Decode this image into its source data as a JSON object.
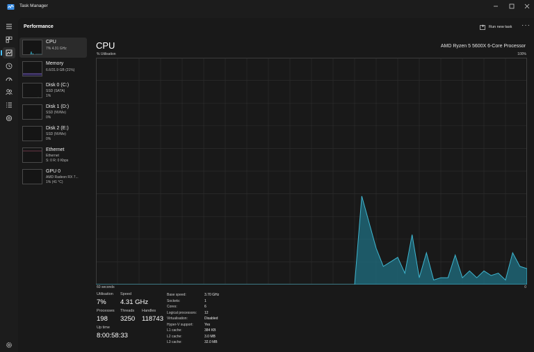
{
  "window": {
    "title": "Task Manager"
  },
  "header": {
    "page_title": "Performance",
    "run_new_task": "Run new task",
    "more": "···"
  },
  "nav": {
    "icons": [
      "menu-icon",
      "processes-icon",
      "performance-icon",
      "app-history-icon",
      "startup-icon",
      "users-icon",
      "details-icon",
      "services-icon",
      "settings-icon"
    ]
  },
  "resources": [
    {
      "name": "CPU",
      "sub1": "7%  4.31 GHz",
      "sub2": "",
      "sub3": ""
    },
    {
      "name": "Memory",
      "sub1": "6.6/31.9 GB (21%)",
      "sub2": "",
      "sub3": ""
    },
    {
      "name": "Disk 0 (C:)",
      "sub1": "SSD (SATA)",
      "sub2": "1%",
      "sub3": ""
    },
    {
      "name": "Disk 1 (D:)",
      "sub1": "SSD (NVMe)",
      "sub2": "0%",
      "sub3": ""
    },
    {
      "name": "Disk 2 (E:)",
      "sub1": "SSD (NVMe)",
      "sub2": "0%",
      "sub3": ""
    },
    {
      "name": "Ethernet",
      "sub1": "Ethernet",
      "sub2": "S: 0  R: 0 Kbps",
      "sub3": ""
    },
    {
      "name": "GPU 0",
      "sub1": "AMD Radeon RX 7...",
      "sub2": "1% (41 °C)",
      "sub3": ""
    }
  ],
  "detail": {
    "title": "CPU",
    "model": "AMD Ryzen 5 5600X 6-Core Processor",
    "y_label": "% Utilisation",
    "y_max": "100%",
    "x_label": "60 seconds",
    "y_min": "0"
  },
  "stats": {
    "utilisation_label": "Utilisation",
    "utilisation": "7%",
    "speed_label": "Speed",
    "speed": "4.31 GHz",
    "processes_label": "Processes",
    "processes": "198",
    "threads_label": "Threads",
    "threads": "3250",
    "handles_label": "Handles",
    "handles": "118743",
    "uptime_label": "Up time",
    "uptime": "8:00:58:33"
  },
  "specs": [
    {
      "key": "Base speed:",
      "value": "3.70 GHz"
    },
    {
      "key": "Sockets:",
      "value": "1"
    },
    {
      "key": "Cores:",
      "value": "6"
    },
    {
      "key": "Logical processors:",
      "value": "12"
    },
    {
      "key": "Virtualisation:",
      "value": "Disabled"
    },
    {
      "key": "Hyper-V support:",
      "value": "Yes"
    },
    {
      "key": "L1 cache:",
      "value": "384 KB"
    },
    {
      "key": "L2 cache:",
      "value": "3.0 MB"
    },
    {
      "key": "L3 cache:",
      "value": "32.0 MB"
    }
  ],
  "chart_data": {
    "type": "area",
    "ylim": [
      0,
      100
    ],
    "xlim": [
      0,
      60
    ],
    "grid": true,
    "color": "#1f8fa8",
    "x": [
      0,
      36,
      37,
      39,
      40,
      41,
      42,
      43,
      44,
      45,
      46,
      47,
      48,
      49,
      50,
      51,
      52,
      53,
      54,
      55,
      56,
      57,
      58,
      59,
      60
    ],
    "values": [
      0,
      0,
      39,
      16,
      8,
      10,
      12,
      5,
      22,
      3,
      14,
      2,
      3,
      3,
      13,
      3,
      6,
      3,
      6,
      4,
      5,
      2,
      14,
      8,
      7
    ]
  },
  "colors": {
    "accent": "#4cc2ff",
    "cpu_line": "#1f8fa8",
    "memory": "#8a6fd8",
    "disk": "#58b368",
    "ethernet": "#c15c7a",
    "gpu": "#1f8fa8"
  }
}
